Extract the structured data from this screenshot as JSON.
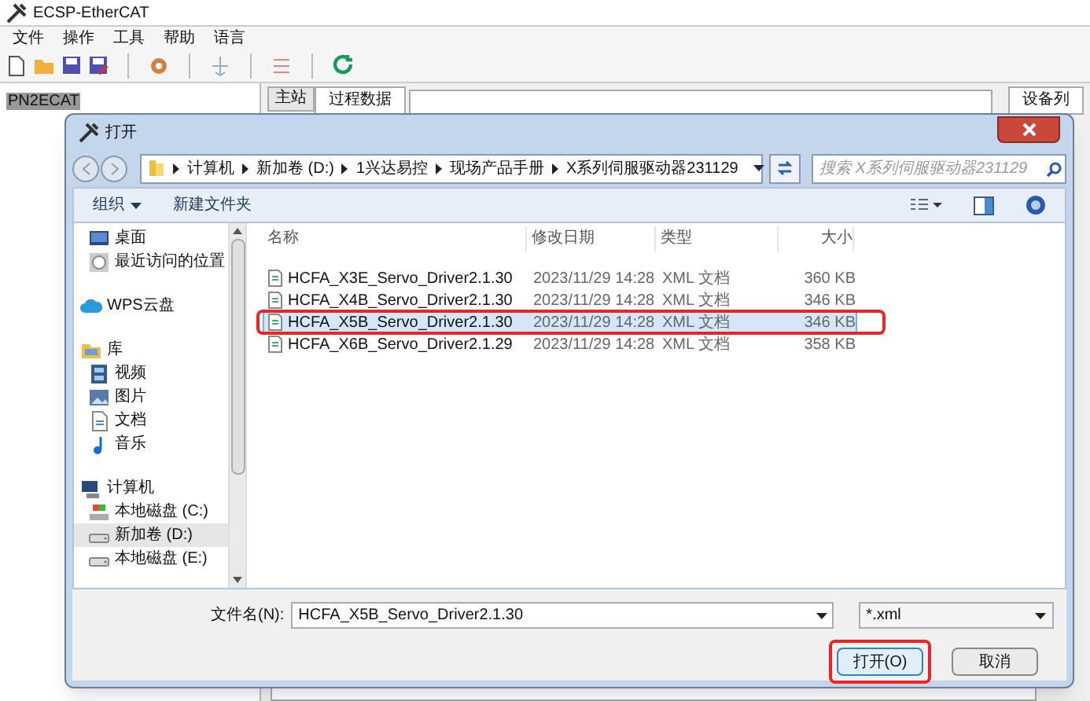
{
  "app": {
    "title": "ECSP-EtherCAT",
    "menu": [
      "文件",
      "操作",
      "工具",
      "帮助",
      "语言"
    ],
    "tree_root": "PN2ECAT",
    "tabs": [
      {
        "label": "主站",
        "selected": false
      },
      {
        "label": "过程数据",
        "selected": true
      }
    ],
    "right_tab": "设备列"
  },
  "dialog": {
    "title": "打开",
    "breadcrumb": [
      "计算机",
      "新加卷 (D:)",
      "1兴达易控",
      "现场产品手册",
      "X系列伺服驱动器231129"
    ],
    "search": {
      "placeholder": "搜索 X系列伺服驱动器231129"
    },
    "toolbar": [
      "组织",
      "新建文件夹"
    ],
    "nav": [
      {
        "label": "桌面",
        "kind": "desktop",
        "selected": false
      },
      {
        "label": "最近访问的位置",
        "kind": "recent",
        "selected": false
      },
      {
        "label": "WPS云盘",
        "kind": "cloud",
        "selected": false
      },
      {
        "label": "库",
        "kind": "library",
        "selected": false
      },
      {
        "label": "视频",
        "kind": "video",
        "selected": false
      },
      {
        "label": "图片",
        "kind": "picture",
        "selected": false
      },
      {
        "label": "文档",
        "kind": "document",
        "selected": false
      },
      {
        "label": "音乐",
        "kind": "music",
        "selected": false
      },
      {
        "label": "计算机",
        "kind": "computer",
        "selected": false
      },
      {
        "label": "本地磁盘 (C:)",
        "kind": "system-drive",
        "selected": false
      },
      {
        "label": "新加卷 (D:)",
        "kind": "drive",
        "selected": true
      },
      {
        "label": "本地磁盘 (E:)",
        "kind": "drive",
        "selected": false
      }
    ],
    "columns": [
      "名称",
      "修改日期",
      "类型",
      "大小"
    ],
    "files": [
      {
        "name": "HCFA_X3E_Servo_Driver2.1.30",
        "date": "2023/11/29 14:28",
        "type": "XML 文档",
        "size": "360 KB",
        "selected": false,
        "outlined": false
      },
      {
        "name": "HCFA_X4B_Servo_Driver2.1.30",
        "date": "2023/11/29 14:28",
        "type": "XML 文档",
        "size": "346 KB",
        "selected": false,
        "outlined": false
      },
      {
        "name": "HCFA_X5B_Servo_Driver2.1.30",
        "date": "2023/11/29 14:28",
        "type": "XML 文档",
        "size": "346 KB",
        "selected": true,
        "outlined": true
      },
      {
        "name": "HCFA_X6B_Servo_Driver2.1.29",
        "date": "2023/11/29 14:28",
        "type": "XML 文档",
        "size": "358 KB",
        "selected": false,
        "outlined": false
      }
    ],
    "filename_label": "文件名(N):",
    "filename": "HCFA_X5B_Servo_Driver2.1.30",
    "filter": "*.xml",
    "buttons": [
      {
        "label": "打开(O)",
        "outlined": true
      },
      {
        "label": "取消"
      }
    ]
  }
}
